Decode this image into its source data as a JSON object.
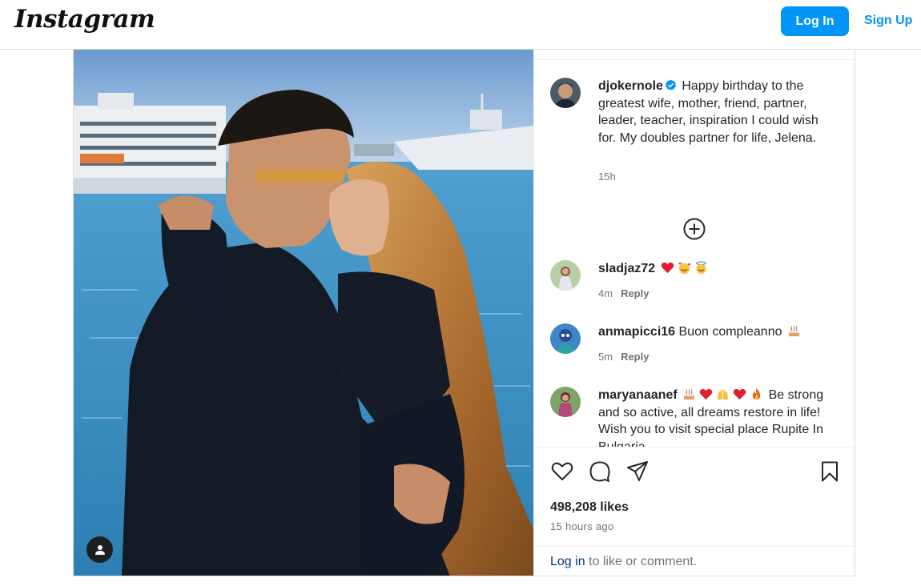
{
  "header": {
    "logo": "Instagram",
    "login_label": "Log In",
    "signup_label": "Sign Up"
  },
  "post": {
    "author": {
      "username": "djokernole",
      "verified": true,
      "caption": "Happy birthday to the greatest wife, mother, friend, partner, leader, teacher, inspiration I could wish for. My doubles partner for life, Jelena.",
      "time": "15h"
    },
    "comments": [
      {
        "username": "sladjaz72",
        "text": "",
        "emojis": [
          "red-heart",
          "smiling-face-with-hearts",
          "smiling-face-with-halo"
        ],
        "time": "4m",
        "reply_label": "Reply"
      },
      {
        "username": "anmapicci16",
        "text": "Buon compleanno",
        "emojis": [
          "birthday-cake"
        ],
        "time": "5m",
        "reply_label": "Reply"
      },
      {
        "username": "maryanaanef",
        "text": "Be strong and so active, all dreams restore in life! Wish you to visit special place Rupite In Bulgaria",
        "emojis": [
          "birthday-cake",
          "red-heart",
          "raising-hands",
          "red-heart",
          "fire"
        ],
        "time": "",
        "reply_label": ""
      }
    ],
    "likes": "498,208 likes",
    "timestamp": "15 hours ago",
    "login_prompt": {
      "link": "Log in",
      "rest": " to like or comment."
    }
  },
  "colors": {
    "accent": "#0095f6",
    "text": "#262626",
    "secondary": "#737373",
    "border": "#dbdbdb"
  },
  "icons": [
    "add-circle-icon",
    "heart-icon",
    "comment-icon",
    "share-icon",
    "bookmark-icon",
    "verified-badge-icon",
    "user-tag-icon"
  ]
}
